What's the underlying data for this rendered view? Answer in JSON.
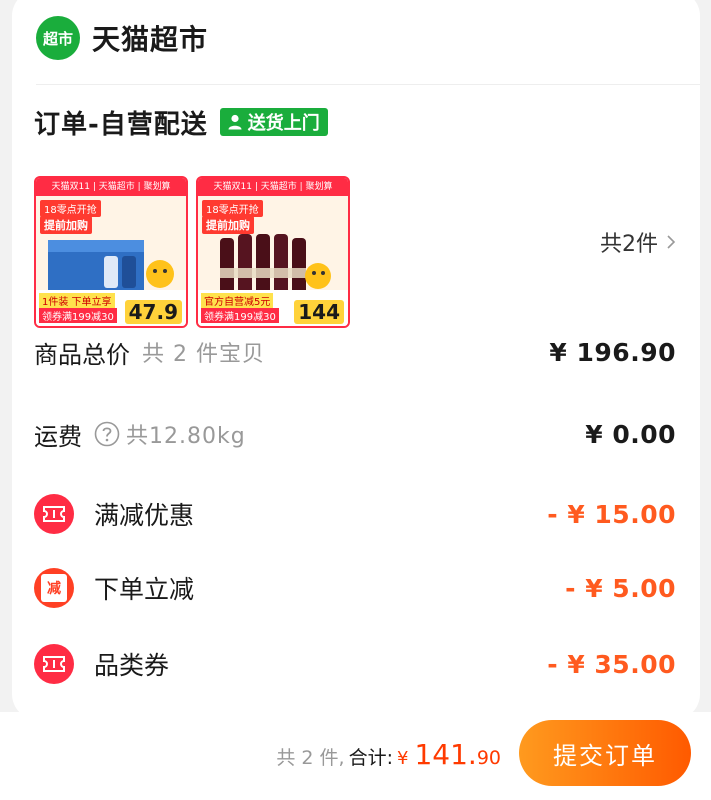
{
  "store": {
    "logo_text": "超市",
    "name": "天猫超市"
  },
  "order": {
    "title": "订单-自营配送",
    "delivery_badge": "送货上门"
  },
  "products": [
    {
      "top_banner": "天猫双11 | 天猫超市 | 聚划算",
      "tag1": "18零点开抢",
      "tag2": "提前加购",
      "line1": "1件装 下单立享",
      "line2": "领券满199减30",
      "price": "47.9",
      "art": "beer-case"
    },
    {
      "top_banner": "天猫双11 | 天猫超市 | 聚划算",
      "tag1": "18零点开抢",
      "tag2": "提前加购",
      "line1": "官方自营减5元",
      "line2": "领券满199减30",
      "price": "144",
      "art": "wine-bottles"
    }
  ],
  "item_count": "共2件",
  "summary": {
    "goods_total_label": "商品总价",
    "goods_total_sub": "共 2 件宝贝",
    "goods_total_value": "¥ 196.90",
    "shipping_label": "运费",
    "shipping_sub": "共12.80kg",
    "shipping_value": "¥ 0.00"
  },
  "discounts": [
    {
      "label": "满减优惠",
      "value": "- ¥ 15.00",
      "icon": "ticket-icon"
    },
    {
      "label": "下单立减",
      "value": "- ¥ 5.00",
      "icon": "jian-icon",
      "icon_text": "减"
    },
    {
      "label": "品类券",
      "value": "- ¥ 35.00",
      "icon": "ticket-icon"
    }
  ],
  "footer": {
    "count_text": "共 2 件,",
    "total_label": "合计:",
    "currency": "¥",
    "total_int": "141.",
    "total_dec": "90",
    "submit_label": "提交订单"
  },
  "colors": {
    "brand_green": "#1aad3c",
    "discount_orange": "#ff5a1f",
    "submit_gradient_start": "#ff9a1e",
    "submit_gradient_end": "#ff5a00"
  }
}
